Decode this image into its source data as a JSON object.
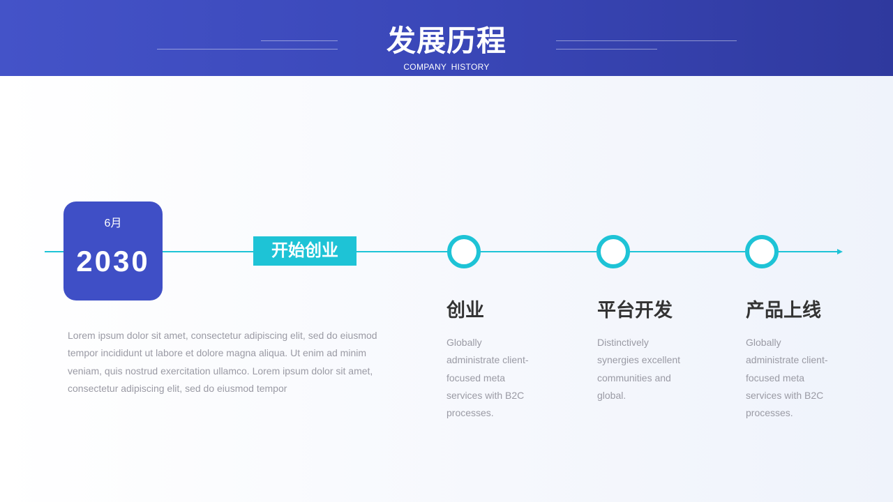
{
  "header": {
    "title": "发展历程",
    "subtitle": "COMPANY HISTORY"
  },
  "colors": {
    "header_start": "#4453c8",
    "header_end": "#2f399e",
    "accent_cyan": "#1ec3d6",
    "card_blue": "#3f4fc6",
    "heading_text": "#333333",
    "body_text": "#9a9aa4"
  },
  "timeline": {
    "month": "6月",
    "year": "2030",
    "milestone": "开始创业",
    "intro": "Lorem ipsum dolor sit amet, consectetur adipiscing elit, sed do eiusmod tempor incididunt ut labore et dolore magna aliqua. Ut enim ad minim veniam, quis nostrud exercitation ullamco. Lorem ipsum dolor sit amet, consectetur adipiscing elit, sed do eiusmod tempor",
    "stages": [
      {
        "title": "创业",
        "desc": "Globally administrate client-focused meta services with B2C processes."
      },
      {
        "title": "平台开发",
        "desc": "Distinctively synergies excellent communities and global."
      },
      {
        "title": "产品上线",
        "desc": "Globally administrate client-focused meta services with B2C processes."
      }
    ]
  }
}
